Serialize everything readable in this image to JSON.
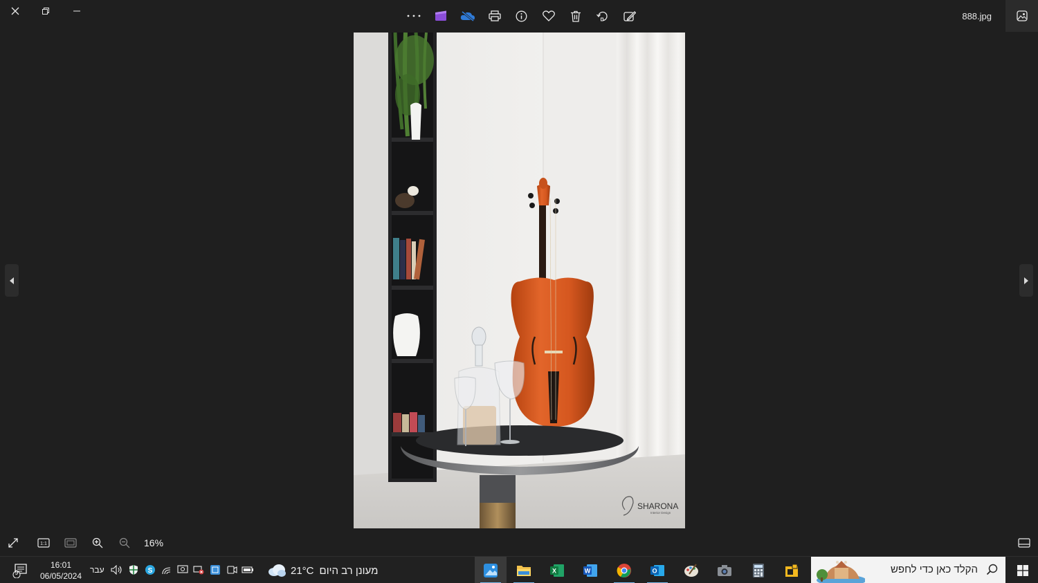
{
  "window": {
    "filename": "888.jpg",
    "controls": [
      "close",
      "restore",
      "minimize"
    ]
  },
  "toolbar": {
    "icons": [
      "more-icon",
      "video-editor-icon",
      "onedrive-icon",
      "print-icon",
      "info-icon",
      "favorite-icon",
      "delete-icon",
      "rotate-icon",
      "edit-image-icon"
    ]
  },
  "photo": {
    "watermark_brand": "SHARONA",
    "watermark_sub": "Interior Design"
  },
  "bottombar": {
    "zoom_label": "16%"
  },
  "taskbar": {
    "notification_count": "9",
    "time": "16:01",
    "date": "06/05/2024",
    "language": "עבר",
    "weather_temp": "21°C",
    "weather_desc": "מעונן רב היום",
    "search_placeholder": "הקלד כאן כדי לחפש",
    "apps": [
      "photos",
      "file-explorer",
      "excel",
      "word",
      "chrome",
      "outlook",
      "paint",
      "camera",
      "calculator",
      "sticky-app"
    ]
  },
  "colors": {
    "background": "#1f1f1f",
    "taskbar": "#212121",
    "accent": "#76b9ed",
    "cello": "#d5571f"
  }
}
